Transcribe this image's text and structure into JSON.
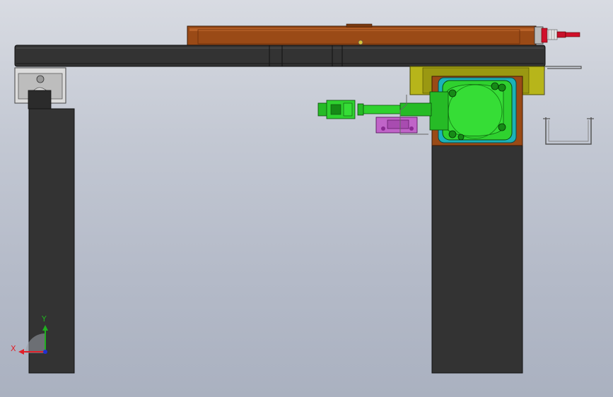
{
  "view": {
    "background_top": "#d8dbe2",
    "background_bottom": "#aab1c0"
  },
  "triad": {
    "x_label": "X",
    "y_label": "Y",
    "x_color": "#e0202a",
    "y_color": "#20b020",
    "z_color": "#2030d0"
  },
  "colors": {
    "frame_dark": "#333333",
    "frame_outline": "#111111",
    "wood": "#9a4a16",
    "wood_highlight": "#b96228",
    "motor_green": "#2fd12f",
    "motor_dark_green": "#168a16",
    "flange_cyan": "#1bb2b8",
    "bracket_yellow": "#b7b51a",
    "connector_magenta": "#c064c8",
    "sensor_red": "#d0102a",
    "rail_block": "#dcdcdc"
  }
}
